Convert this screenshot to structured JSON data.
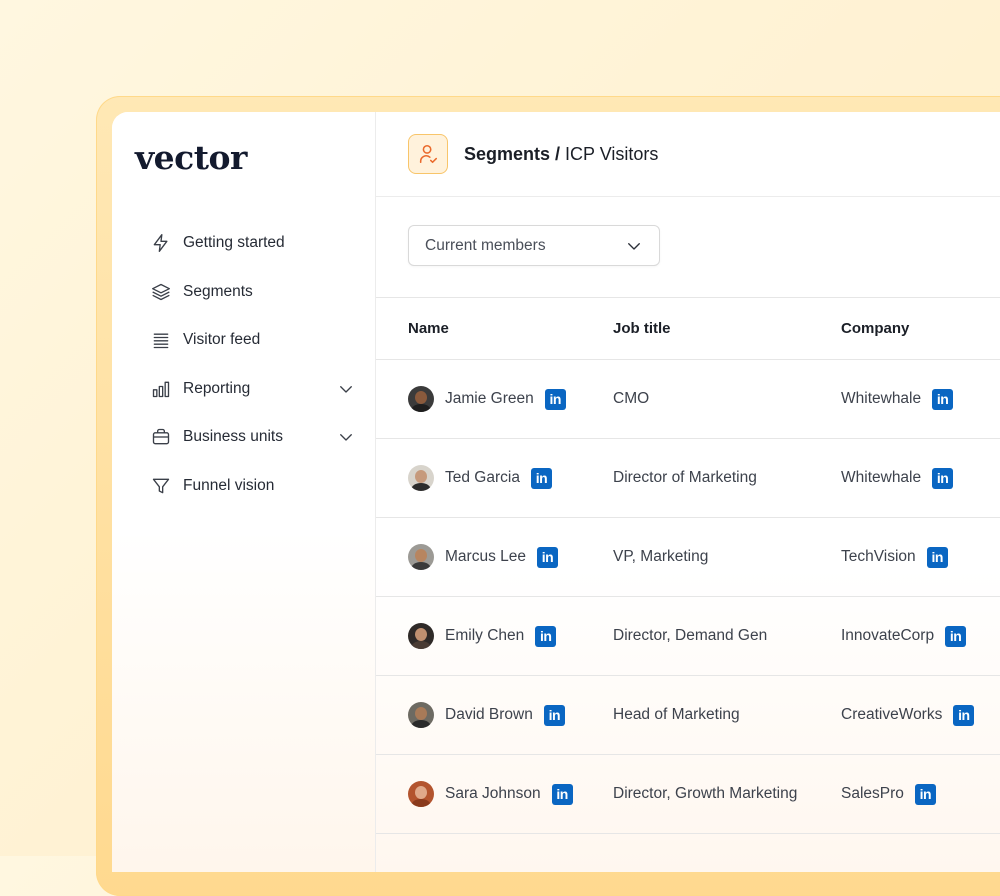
{
  "app": {
    "logo": "vector"
  },
  "sidebar": {
    "items": [
      {
        "label": "Getting started",
        "icon": "lightning-icon"
      },
      {
        "label": "Segments",
        "icon": "layers-icon"
      },
      {
        "label": "Visitor feed",
        "icon": "list-icon"
      },
      {
        "label": "Reporting",
        "icon": "bar-chart-icon",
        "expandable": true
      },
      {
        "label": "Business units",
        "icon": "briefcase-icon",
        "expandable": true
      },
      {
        "label": "Funnel vision",
        "icon": "funnel-icon"
      }
    ]
  },
  "header": {
    "breadcrumb_parent": "Segments /",
    "breadcrumb_current": "ICP Visitors",
    "icon": "user-check-icon"
  },
  "filter": {
    "selected": "Current members"
  },
  "table": {
    "columns": [
      "Name",
      "Job title",
      "Company"
    ],
    "rows": [
      {
        "name": "Jamie Green",
        "title": "CMO",
        "company": "Whitewhale"
      },
      {
        "name": "Ted Garcia",
        "title": "Director of Marketing",
        "company": "Whitewhale"
      },
      {
        "name": "Marcus Lee",
        "title": "VP, Marketing",
        "company": "TechVision"
      },
      {
        "name": "Emily Chen",
        "title": "Director, Demand Gen",
        "company": "InnovateCorp"
      },
      {
        "name": "David Brown",
        "title": "Head of Marketing",
        "company": "CreativeWorks"
      },
      {
        "name": "Sara Johnson",
        "title": "Director, Growth Marketing",
        "company": "SalesPro"
      }
    ]
  },
  "colors": {
    "accent": "#f8c56a",
    "linkedin": "#0a66c2",
    "frame": "#ffd98f"
  }
}
